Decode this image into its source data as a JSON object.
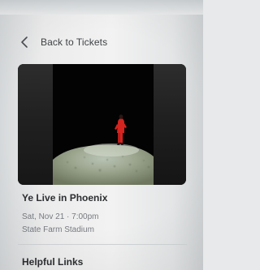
{
  "nav": {
    "back_label": "Back to Tickets"
  },
  "event": {
    "title": "Ye Live in Phoenix",
    "date_time": "Sat, Nov 21 · 7:00pm",
    "venue": "State Farm Stadium"
  },
  "sections": {
    "helpful_links_title": "Helpful Links"
  },
  "icons": {
    "back": "chevron-left-icon"
  },
  "colors": {
    "page_background": "#f2f2f2",
    "primary_text": "#2c2e31",
    "secondary_text": "#777b80",
    "hero_background": "#050505",
    "performer_outfit": "#d3241f"
  }
}
